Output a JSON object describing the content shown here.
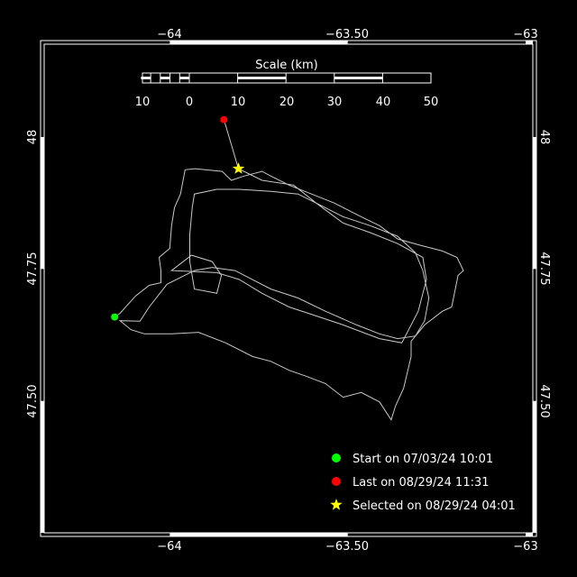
{
  "map": {
    "background": "#000000",
    "frame_color": "#ffffff",
    "track_color": "#c8c8c8",
    "lon_range": [
      -64.353,
      -62.98
    ],
    "lat_range": [
      47.25,
      48.176
    ],
    "lon_ticks": [
      {
        "value": -64,
        "label": "−64"
      },
      {
        "value": -63.5,
        "label": "−63.50"
      },
      {
        "value": -63,
        "label": "−63"
      }
    ],
    "lat_ticks": [
      {
        "value": 48,
        "label": "48"
      },
      {
        "value": 47.75,
        "label": "47.75"
      },
      {
        "value": 47.5,
        "label": "47.50"
      }
    ]
  },
  "scale_bar": {
    "title": "Scale (km)",
    "labels": [
      "10",
      "0",
      "10",
      "20",
      "30",
      "40",
      "50"
    ]
  },
  "track": {
    "points": [
      [
        -64.155,
        47.659
      ],
      [
        -64.14,
        47.666
      ],
      [
        -64.096,
        47.699
      ],
      [
        -64.058,
        47.719
      ],
      [
        -64.025,
        47.724
      ],
      [
        -64.025,
        47.747
      ],
      [
        -64.03,
        47.772
      ],
      [
        -64.0,
        47.789
      ],
      [
        -63.995,
        47.832
      ],
      [
        -63.987,
        47.866
      ],
      [
        -63.97,
        47.892
      ],
      [
        -63.957,
        47.938
      ],
      [
        -63.929,
        47.94
      ],
      [
        -63.853,
        47.935
      ],
      [
        -63.827,
        47.918
      ],
      [
        -63.792,
        47.926
      ],
      [
        -63.741,
        47.935
      ],
      [
        -63.716,
        47.926
      ],
      [
        -63.665,
        47.909
      ],
      [
        -63.602,
        47.892
      ],
      [
        -63.538,
        47.875
      ],
      [
        -63.462,
        47.849
      ],
      [
        -63.411,
        47.832
      ],
      [
        -63.36,
        47.807
      ],
      [
        -63.297,
        47.795
      ],
      [
        -63.234,
        47.784
      ],
      [
        -63.193,
        47.772
      ],
      [
        -63.175,
        47.747
      ],
      [
        -63.19,
        47.738
      ],
      [
        -63.208,
        47.678
      ],
      [
        -63.234,
        47.67
      ],
      [
        -63.284,
        47.644
      ],
      [
        -63.322,
        47.613
      ],
      [
        -63.322,
        47.584
      ],
      [
        -63.343,
        47.524
      ],
      [
        -63.366,
        47.49
      ],
      [
        -63.378,
        47.464
      ],
      [
        -63.411,
        47.498
      ],
      [
        -63.462,
        47.516
      ],
      [
        -63.513,
        47.507
      ],
      [
        -63.563,
        47.533
      ],
      [
        -63.614,
        47.546
      ],
      [
        -63.665,
        47.558
      ],
      [
        -63.716,
        47.575
      ],
      [
        -63.767,
        47.584
      ],
      [
        -63.843,
        47.61
      ],
      [
        -63.919,
        47.63
      ],
      [
        -63.995,
        47.627
      ],
      [
        -64.071,
        47.627
      ],
      [
        -64.109,
        47.635
      ],
      [
        -64.14,
        47.652
      ],
      [
        -64.084,
        47.651
      ],
      [
        -64.058,
        47.678
      ],
      [
        -64.008,
        47.721
      ],
      [
        -63.931,
        47.747
      ],
      [
        -63.881,
        47.753
      ],
      [
        -63.817,
        47.747
      ],
      [
        -63.716,
        47.712
      ],
      [
        -63.64,
        47.695
      ],
      [
        -63.563,
        47.67
      ],
      [
        -63.475,
        47.644
      ],
      [
        -63.411,
        47.627
      ],
      [
        -63.36,
        47.618
      ],
      [
        -63.31,
        47.623
      ],
      [
        -63.284,
        47.652
      ],
      [
        -63.272,
        47.695
      ],
      [
        -63.289,
        47.747
      ],
      [
        -63.31,
        47.781
      ],
      [
        -63.36,
        47.812
      ],
      [
        -63.437,
        47.832
      ],
      [
        -63.513,
        47.849
      ],
      [
        -63.589,
        47.875
      ],
      [
        -63.64,
        47.892
      ],
      [
        -63.716,
        47.897
      ],
      [
        -63.805,
        47.901
      ],
      [
        -63.868,
        47.901
      ],
      [
        -63.931,
        47.892
      ],
      [
        -63.937,
        47.866
      ],
      [
        -63.944,
        47.815
      ],
      [
        -63.944,
        47.764
      ],
      [
        -63.931,
        47.712
      ],
      [
        -63.868,
        47.704
      ],
      [
        -63.855,
        47.738
      ],
      [
        -63.881,
        47.764
      ],
      [
        -63.939,
        47.776
      ],
      [
        -63.995,
        47.747
      ],
      [
        -63.868,
        47.743
      ],
      [
        -63.805,
        47.73
      ],
      [
        -63.741,
        47.704
      ],
      [
        -63.665,
        47.678
      ],
      [
        -63.589,
        47.661
      ],
      [
        -63.513,
        47.644
      ],
      [
        -63.411,
        47.618
      ],
      [
        -63.348,
        47.61
      ],
      [
        -63.302,
        47.67
      ],
      [
        -63.279,
        47.73
      ],
      [
        -63.289,
        47.772
      ],
      [
        -63.36,
        47.798
      ],
      [
        -63.437,
        47.819
      ],
      [
        -63.513,
        47.837
      ],
      [
        -63.589,
        47.875
      ],
      [
        -63.652,
        47.909
      ],
      [
        -63.741,
        47.918
      ],
      [
        -63.807,
        47.94
      ],
      [
        -63.848,
        48.033
      ]
    ],
    "start": {
      "lon": -64.155,
      "lat": 47.659,
      "color": "#00ff00"
    },
    "last": {
      "lon": -63.848,
      "lat": 48.033,
      "color": "#ff0000"
    },
    "selected": {
      "lon": -63.807,
      "lat": 47.94,
      "color": "#ffff00"
    }
  },
  "legend": {
    "items": [
      {
        "icon": "green-dot",
        "color": "#00ff00",
        "label": "Start on 07/03/24 10:01"
      },
      {
        "icon": "red-dot",
        "color": "#ff0000",
        "label": "Last on 08/29/24 11:31"
      },
      {
        "icon": "yellow-star",
        "color": "#ffff00",
        "label": "Selected on 08/29/24 04:01"
      }
    ]
  }
}
